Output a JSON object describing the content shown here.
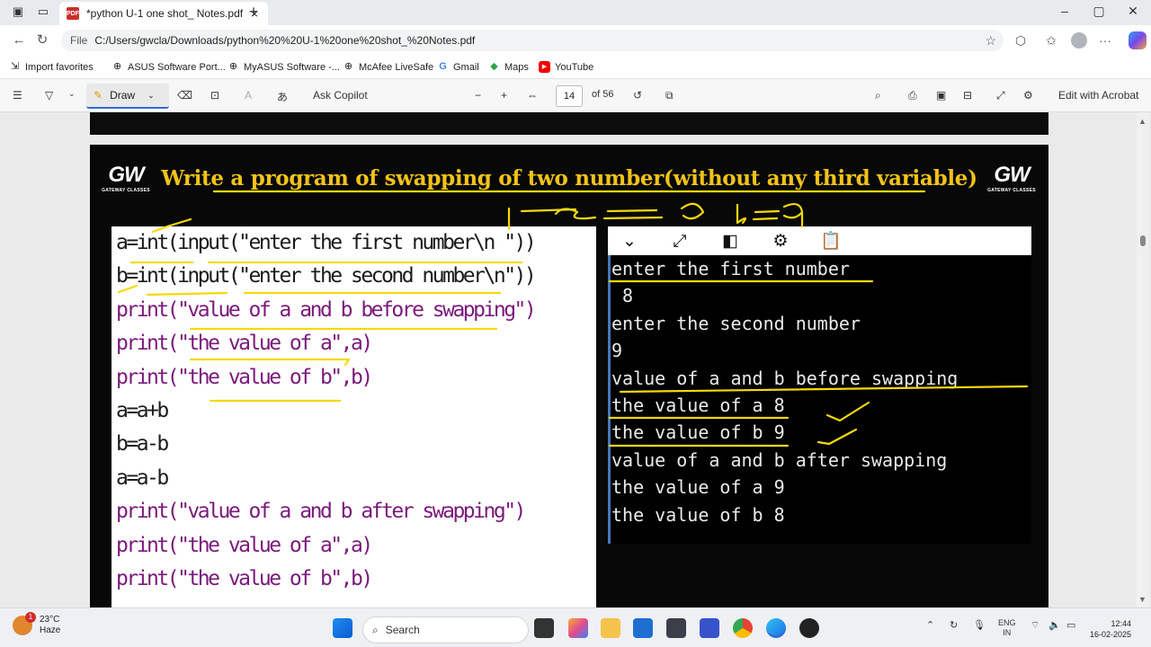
{
  "browser": {
    "tab_title": "*python U-1 one shot_ Notes.pdf",
    "url_label": "File",
    "url": "C:/Users/gwcla/Downloads/python%20%20U-1%20one%20shot_%20Notes.pdf"
  },
  "favorites": [
    {
      "label": "Import favorites",
      "icon": "import-icon"
    },
    {
      "label": "ASUS Software Port...",
      "icon": "globe-icon"
    },
    {
      "label": "MyASUS Software -...",
      "icon": "globe-icon"
    },
    {
      "label": "McAfee LiveSafe",
      "icon": "globe-icon"
    },
    {
      "label": "Gmail",
      "icon": "google-icon"
    },
    {
      "label": "Maps",
      "icon": "maps-icon"
    },
    {
      "label": "YouTube",
      "icon": "youtube-icon"
    }
  ],
  "pdf_toolbar": {
    "draw_label": "Draw",
    "ask_copilot": "Ask Copilot",
    "page_number": "14",
    "page_total": "of 56",
    "edit_acrobat": "Edit with Acrobat"
  },
  "slide": {
    "logo_text": "GW",
    "logo_sub": "GATEWAY CLASSES",
    "heading": "Write a program of swapping of two number(without any third variable)",
    "code_lines": [
      "a=int(input(\"enter the first number\\n \"))",
      "b=int(input(\"enter the second number\\n\"))",
      "print(\"value of a and b before swapping\")",
      "print(\"the value of a\",a)",
      "print(\"the value of b\",b)",
      "a=a+b",
      "b=a-b",
      "a=a-b",
      "print(\"value of a and b after swapping\")",
      "print(\"the value of a\",a)",
      "print(\"the value of b\",b)"
    ],
    "output_lines": [
      "enter the first number",
      " 8",
      "enter the second number",
      "9",
      "value of a and b before swapping",
      "the value of a 8",
      "the value of b 9",
      "value of a and b after swapping",
      "the value of a 9",
      "the value of b 8"
    ],
    "output_icons": [
      "chevron-down-icon",
      "expand-icon",
      "layout-icon",
      "gear-icon",
      "clipboard-icon"
    ],
    "handwriting": "a = 8  b = 9"
  },
  "taskbar": {
    "temperature": "23°C",
    "weather": "Haze",
    "weather_badge": "1",
    "search_label": "Search",
    "lang": "ENG",
    "region": "IN",
    "time": "12:44",
    "date": "16-02-2025"
  },
  "colors": {
    "heading": "#f2c318",
    "annotation": "#f5d90a",
    "output_bg": "#000000",
    "accent": "#2b6cd4"
  }
}
